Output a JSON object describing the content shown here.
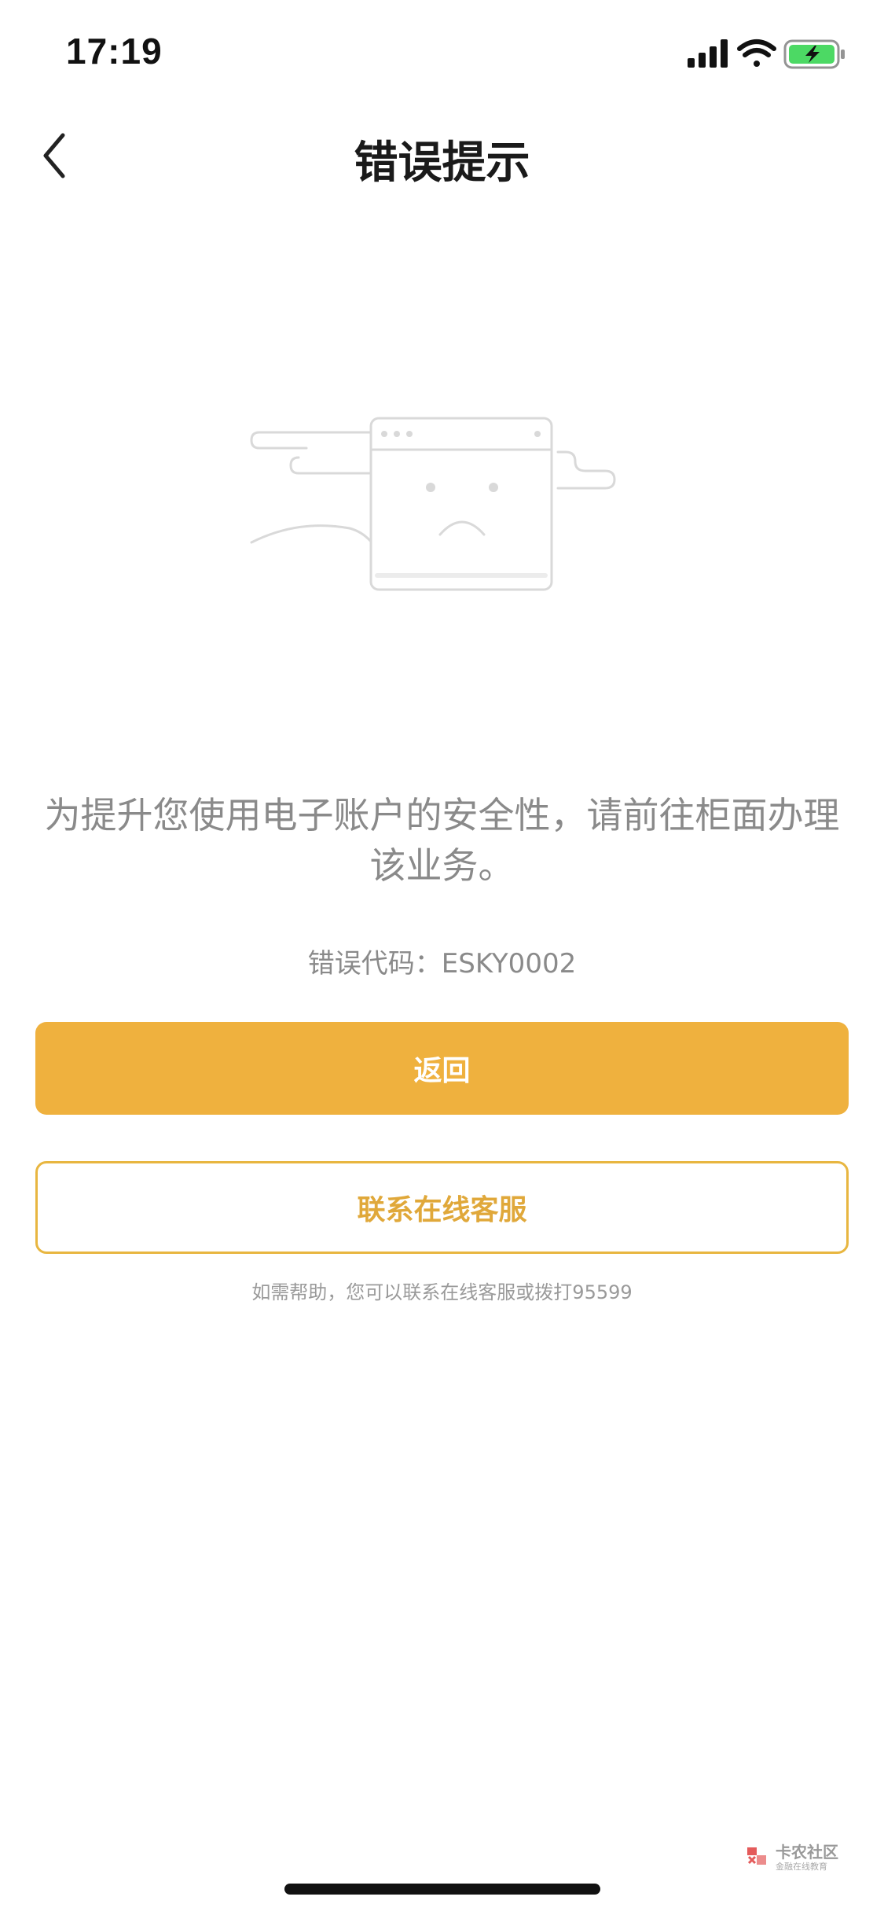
{
  "status_bar": {
    "time": "17:19",
    "signal_icon": "cellular-signal-icon",
    "wifi_icon": "wifi-icon",
    "battery_icon": "battery-charging-icon",
    "battery_color": "#4cd964"
  },
  "nav": {
    "back_icon": "chevron-left-icon",
    "title": "错误提示"
  },
  "illustration": {
    "icon": "sad-browser-window-icon"
  },
  "message": "为提升您使用电子账户的安全性，请前往柜面办理该业务。",
  "error_code": "错误代码：ESKY0002",
  "buttons": {
    "primary_label": "返回",
    "secondary_label": "联系在线客服"
  },
  "help_text": "如需帮助，您可以联系在线客服或拨打95599",
  "watermark": {
    "name": "卡农社区",
    "subtitle": "金融在线教育"
  },
  "colors": {
    "accent": "#efb13e",
    "accent_border": "#e8b640",
    "muted_text": "#8a8a8a"
  }
}
